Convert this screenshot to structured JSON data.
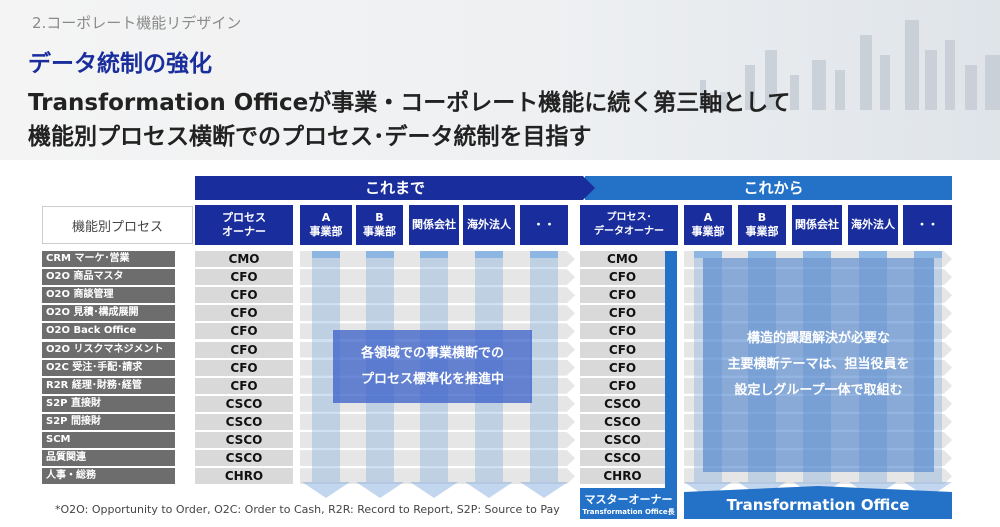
{
  "header": {
    "section": "2.コーポレート機能リデザイン",
    "subtitle": "データ統制の強化",
    "headline_1": "Transformation Officeが事業・コーポレート機能に続く第三軸として",
    "headline_2": "機能別プロセス横断でのプロセス･データ統制を目指す"
  },
  "colors": {
    "dark_blue": "#1a2d9c",
    "blue": "#2472c8",
    "gray": "#6d6d6d"
  },
  "before": {
    "band": "これまで",
    "owner_header": "プロセス\nオーナー",
    "columns": [
      "A\n事業部",
      "B\n事業部",
      "関係会社",
      "海外法人",
      "・・"
    ],
    "message_1": "各領域での事業横断での",
    "message_2": "プロセス標準化を推進中"
  },
  "after": {
    "band": "これから",
    "owner_header": "プロセス･\nデータオーナー",
    "columns": [
      "A\n事業部",
      "B\n事業部",
      "関係会社",
      "海外法人",
      "・・"
    ],
    "message_1": "構造的課題解決が必要な",
    "message_2": "主要横断テーマは、担当役員を",
    "message_3": "設定しグループ一体で取組む",
    "master_owner": "マスターオーナー",
    "master_owner_sub": "Transformation Office長",
    "office": "Transformation Office"
  },
  "process_header": "機能別プロセス",
  "rows": [
    {
      "process": "CRM マーケ･営業",
      "owner": "CMO"
    },
    {
      "process": "O2O 商品マスタ",
      "owner": "CFO"
    },
    {
      "process": "O2O 商談管理",
      "owner": "CFO"
    },
    {
      "process": "O2O 見積･構成展開",
      "owner": "CFO"
    },
    {
      "process": "O2O Back Office",
      "owner": "CFO"
    },
    {
      "process": "O2O リスクマネジメント",
      "owner": "CFO"
    },
    {
      "process": "O2C 受注･手配･請求",
      "owner": "CFO"
    },
    {
      "process": "R2R 経理･財務･経管",
      "owner": "CFO"
    },
    {
      "process": "S2P 直接財",
      "owner": "CSCO"
    },
    {
      "process": "S2P 間接財",
      "owner": "CSCO"
    },
    {
      "process": "SCM",
      "owner": "CSCO"
    },
    {
      "process": "品質関連",
      "owner": "CSCO"
    },
    {
      "process": "人事・総務",
      "owner": "CHRO"
    }
  ],
  "footnote": "*O2O: Opportunity to Order, O2C: Order to Cash, R2R: Record to Report, S2P: Source to Pay"
}
